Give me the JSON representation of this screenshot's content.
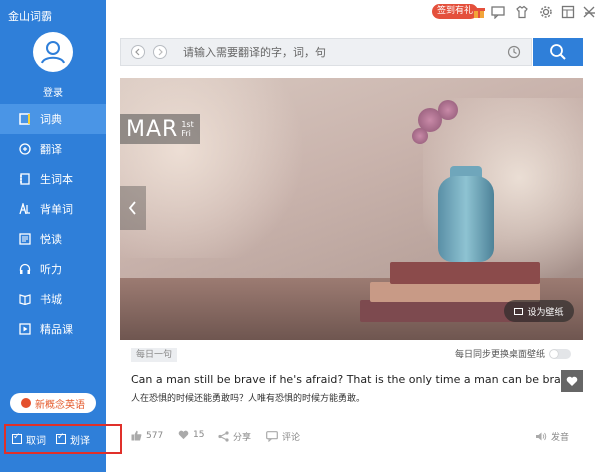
{
  "app": {
    "title": "金山词霸"
  },
  "user": {
    "login_label": "登录"
  },
  "nav": {
    "items": [
      {
        "label": "词典",
        "icon": "book-icon",
        "active": true
      },
      {
        "label": "翻译",
        "icon": "translate-icon",
        "active": false
      },
      {
        "label": "生词本",
        "icon": "notebook-icon",
        "active": false
      },
      {
        "label": "背单词",
        "icon": "flashcard-icon",
        "active": false
      },
      {
        "label": "悦读",
        "icon": "reading-icon",
        "active": false
      },
      {
        "label": "听力",
        "icon": "headphones-icon",
        "active": false
      },
      {
        "label": "书城",
        "icon": "bookstore-icon",
        "active": false
      },
      {
        "label": "精品课",
        "icon": "video-course-icon",
        "active": false
      }
    ]
  },
  "promo": {
    "label": "新概念英语"
  },
  "footer": {
    "fetch_word": "取词",
    "select_translate": "划译"
  },
  "topbar": {
    "signin_label": "签到有礼"
  },
  "search": {
    "placeholder": "请输入需要翻译的字，词，句"
  },
  "banner": {
    "month": "MAR",
    "day": "1st",
    "weekday": "Fri",
    "set_wallpaper": "设为壁纸"
  },
  "daily": {
    "tag": "每日一句",
    "sync_label": "每日同步更换桌面壁纸",
    "sentence_en": "Can a man still be brave if he's afraid? That is the only time a man can be brave.",
    "sentence_zh": "人在恐惧的时候还能勇敢吗？人唯有恐惧的时候方能勇敢。",
    "likes": "577",
    "favorites": "15",
    "share": "分享",
    "comment": "评论",
    "pronounce": "发音"
  },
  "colors": {
    "primary": "#2f7fd9",
    "active_nav": "#4a95e6",
    "highlight_border": "#e0302a",
    "signin": "#e4503c"
  }
}
